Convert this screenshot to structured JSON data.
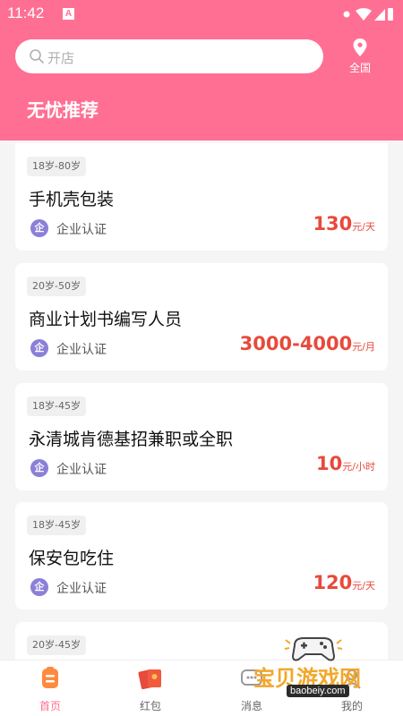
{
  "status_bar": {
    "time": "11:42",
    "badge": "A"
  },
  "search": {
    "placeholder": "开店"
  },
  "location": {
    "label": "全国"
  },
  "section": {
    "title": "无忧推荐"
  },
  "jobs": [
    {
      "age": "18岁-80岁",
      "title": "手机壳包装",
      "cert": "企业认证",
      "cert_icon": "企",
      "salary": "130",
      "unit": "元/天"
    },
    {
      "age": "20岁-50岁",
      "title": "商业计划书编写人员",
      "cert": "企业认证",
      "cert_icon": "企",
      "salary": "3000-4000",
      "unit": "元/月"
    },
    {
      "age": "18岁-45岁",
      "title": "永清城肯德基招兼职或全职",
      "cert": "企业认证",
      "cert_icon": "企",
      "salary": "10",
      "unit": "元/小时"
    },
    {
      "age": "18岁-45岁",
      "title": "保安包吃住",
      "cert": "企业认证",
      "cert_icon": "企",
      "salary": "120",
      "unit": "元/天"
    },
    {
      "age": "20岁-45岁"
    }
  ],
  "tabs": [
    {
      "label": "首页",
      "icon": "home-icon"
    },
    {
      "label": "红包",
      "icon": "red-packet-icon"
    },
    {
      "label": "消息",
      "icon": "message-icon"
    },
    {
      "label": "我的",
      "icon": "profile-icon"
    }
  ],
  "watermark": {
    "text": "宝贝游戏网",
    "url": "baobeiy.com"
  },
  "colors": {
    "primary": "#ff6f93",
    "salary": "#e74a3c",
    "cert": "#8a80d8"
  }
}
